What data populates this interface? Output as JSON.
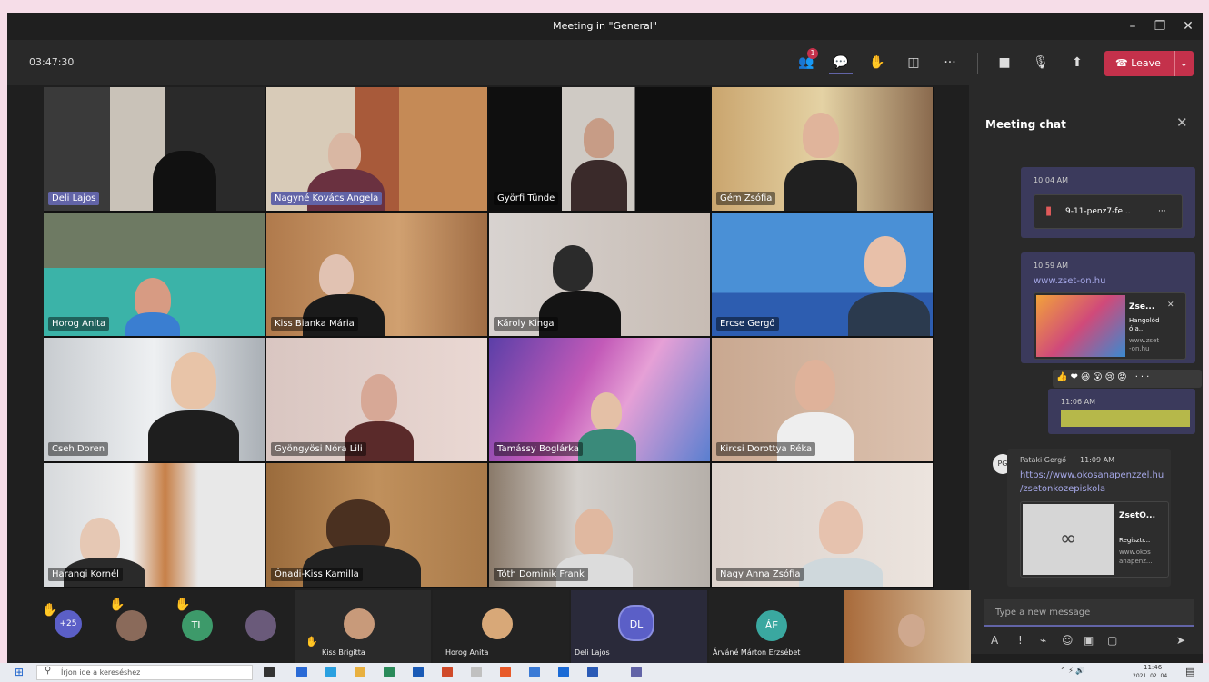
{
  "window": {
    "title": "Meeting in \"General\"",
    "minimize": "–",
    "restore": "❐",
    "close": "✕"
  },
  "toolbar": {
    "clock": "03:47:30",
    "participants_badge": "1",
    "more": "···",
    "leave_label": "Leave",
    "leave_dropdown": "⌄"
  },
  "colors": {
    "accent": "#6264a7",
    "leave": "#c4314b",
    "background": "#1f1f1f"
  },
  "tiles": [
    {
      "name": "Deli Lajos",
      "highlight": true
    },
    {
      "name": "Nagyné Kovács Angela",
      "highlight": true
    },
    {
      "name": "Györfi Tünde"
    },
    {
      "name": "Gém Zsófia"
    },
    {
      "name": "Horog Anita"
    },
    {
      "name": "Kiss Bianka Mária"
    },
    {
      "name": "Károly Kinga"
    },
    {
      "name": "Ercse Gergő"
    },
    {
      "name": "Cseh Doren"
    },
    {
      "name": "Gyöngyösi Nóra Lili"
    },
    {
      "name": "Tamássy Boglárka"
    },
    {
      "name": "Kircsi Dorottya Réka"
    },
    {
      "name": "Harangi Kornél"
    },
    {
      "name": "Ónadi-Kiss Kamilla"
    },
    {
      "name": "Tóth Dominik Frank"
    },
    {
      "name": "Nagy Anna Zsófia"
    }
  ],
  "chat": {
    "title": "Meeting chat",
    "close": "✕",
    "msg1_time": "10:04 AM",
    "file_name": "9-11-penz7-fe...",
    "file_more": "···",
    "msg2_time": "10:59 AM",
    "msg2_link": "www.zset-on.hu",
    "preview_title": "Zse...",
    "preview_close": "✕",
    "preview_desc_1": "Hangolód",
    "preview_desc_2": "ó a...",
    "preview_url_1": "www.zset",
    "preview_url_2": "-on.hu",
    "reactions": "👍❤😆😮😢😡 ···",
    "msg3_time": "11:06 AM",
    "msg4_initials": "PG",
    "msg4_sender": "Pataki Gergő",
    "msg4_time": "11:09 AM",
    "msg4_link_1": "https://www.okosanapenzzel.hu",
    "msg4_link_2": "/zsetonkozepiskola",
    "card_title": "ZsetO...",
    "card_desc": "Regisztr...",
    "card_url_1": "www.okos",
    "card_url_2": "anapenz...",
    "compose_placeholder": "Type a new message"
  },
  "strip": {
    "overflow_count": "+25",
    "tl_initials": "TL",
    "dl_initials": "DL",
    "ae_initials": "ÁE",
    "names": [
      "Kiss Brigitta",
      "Horog Anita",
      "Deli Lajos",
      "Árváné Márton Erzsébet"
    ]
  },
  "taskbar": {
    "search_placeholder": "Írjon ide a kereséshez",
    "time": "11:46",
    "date": "2021. 02. 04."
  }
}
